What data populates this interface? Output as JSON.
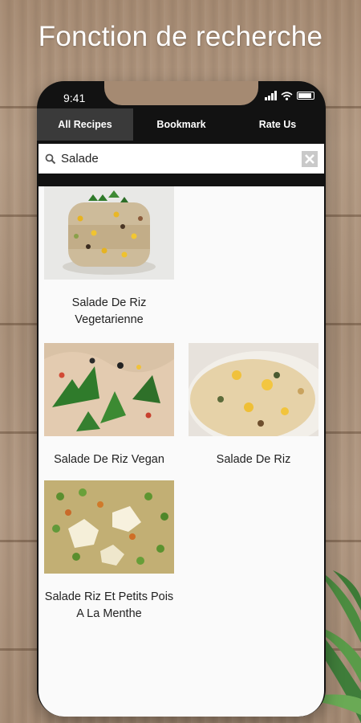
{
  "banner": {
    "title": "Fonction de recherche"
  },
  "status_bar": {
    "time": "9:41"
  },
  "tabs": [
    {
      "label": "All Recipes",
      "active": true
    },
    {
      "label": "Bookmark",
      "active": false
    },
    {
      "label": "Rate Us",
      "active": false
    }
  ],
  "search": {
    "value": "Salade",
    "icons": {
      "search": "search-icon",
      "clear": "close-icon"
    }
  },
  "results": [
    {
      "title": "Salade De Riz Vegetarienne"
    },
    {
      "title": "Salade De Riz Vegan"
    },
    {
      "title": "Salade De Riz"
    },
    {
      "title": "Salade Riz Et Petits Pois A La Menthe"
    }
  ],
  "colors": {
    "tab_bar": "#121212",
    "active_tab": "#3a3a3a",
    "list_background": "#fafafa",
    "wood": "#a58a72"
  }
}
